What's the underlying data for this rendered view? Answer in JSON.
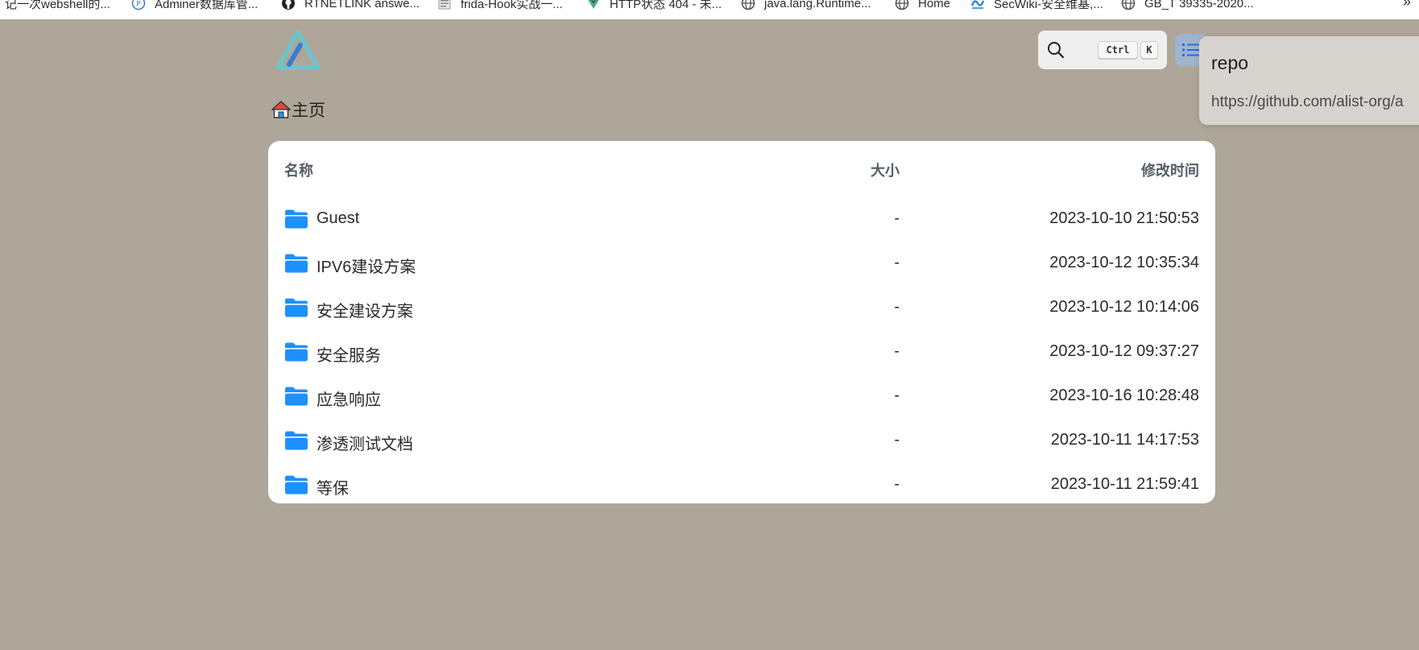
{
  "bookmarks": [
    {
      "label": "记一次webshell的...",
      "icon": "blank-page-icon"
    },
    {
      "label": "Adminer数据库管...",
      "icon": "adminer-icon"
    },
    {
      "label": "RTNETLINK answe...",
      "icon": "github-icon"
    },
    {
      "label": "frida-Hook实战一...",
      "icon": "doc-icon"
    },
    {
      "label": "HTTP状态 404 - 未...",
      "icon": "vue-icon"
    },
    {
      "label": "java.lang.Runtime...",
      "icon": "globe-icon"
    },
    {
      "label": "Home",
      "icon": "globe-icon"
    },
    {
      "label": "SecWiki-安全维基,...",
      "icon": "secwiki-icon"
    },
    {
      "label": "GB_T 39335-2020...",
      "icon": "globe-icon"
    }
  ],
  "bookmarks_more": "»",
  "header": {
    "logo": "alist-logo-icon",
    "search": {
      "icon": "search-icon",
      "shortcut_ctrl": "Ctrl",
      "shortcut_key": "K"
    },
    "list_toggle": "list-icon"
  },
  "popover": {
    "title": "repo",
    "url": "https://github.com/alist-org/a"
  },
  "breadcrumb": {
    "icon": "home-icon",
    "label": "主页"
  },
  "table": {
    "headers": {
      "name": "名称",
      "size": "大小",
      "modified": "修改时间"
    },
    "rows": [
      {
        "name": "Guest",
        "size": "-",
        "modified": "2023-10-10 21:50:53"
      },
      {
        "name": "IPV6建设方案",
        "size": "-",
        "modified": "2023-10-12 10:35:34"
      },
      {
        "name": "安全建设方案",
        "size": "-",
        "modified": "2023-10-12 10:14:06"
      },
      {
        "name": "安全服务",
        "size": "-",
        "modified": "2023-10-12 09:37:27"
      },
      {
        "name": "应急响应",
        "size": "-",
        "modified": "2023-10-16 10:28:48"
      },
      {
        "name": "渗透测试文档",
        "size": "-",
        "modified": "2023-10-11 14:17:53"
      },
      {
        "name": "等保",
        "size": "-",
        "modified": "2023-10-11 21:59:41"
      }
    ]
  },
  "colors": {
    "page_bg": "#aea699",
    "folder": "#1e90ff",
    "accent": "#3b82f6"
  }
}
